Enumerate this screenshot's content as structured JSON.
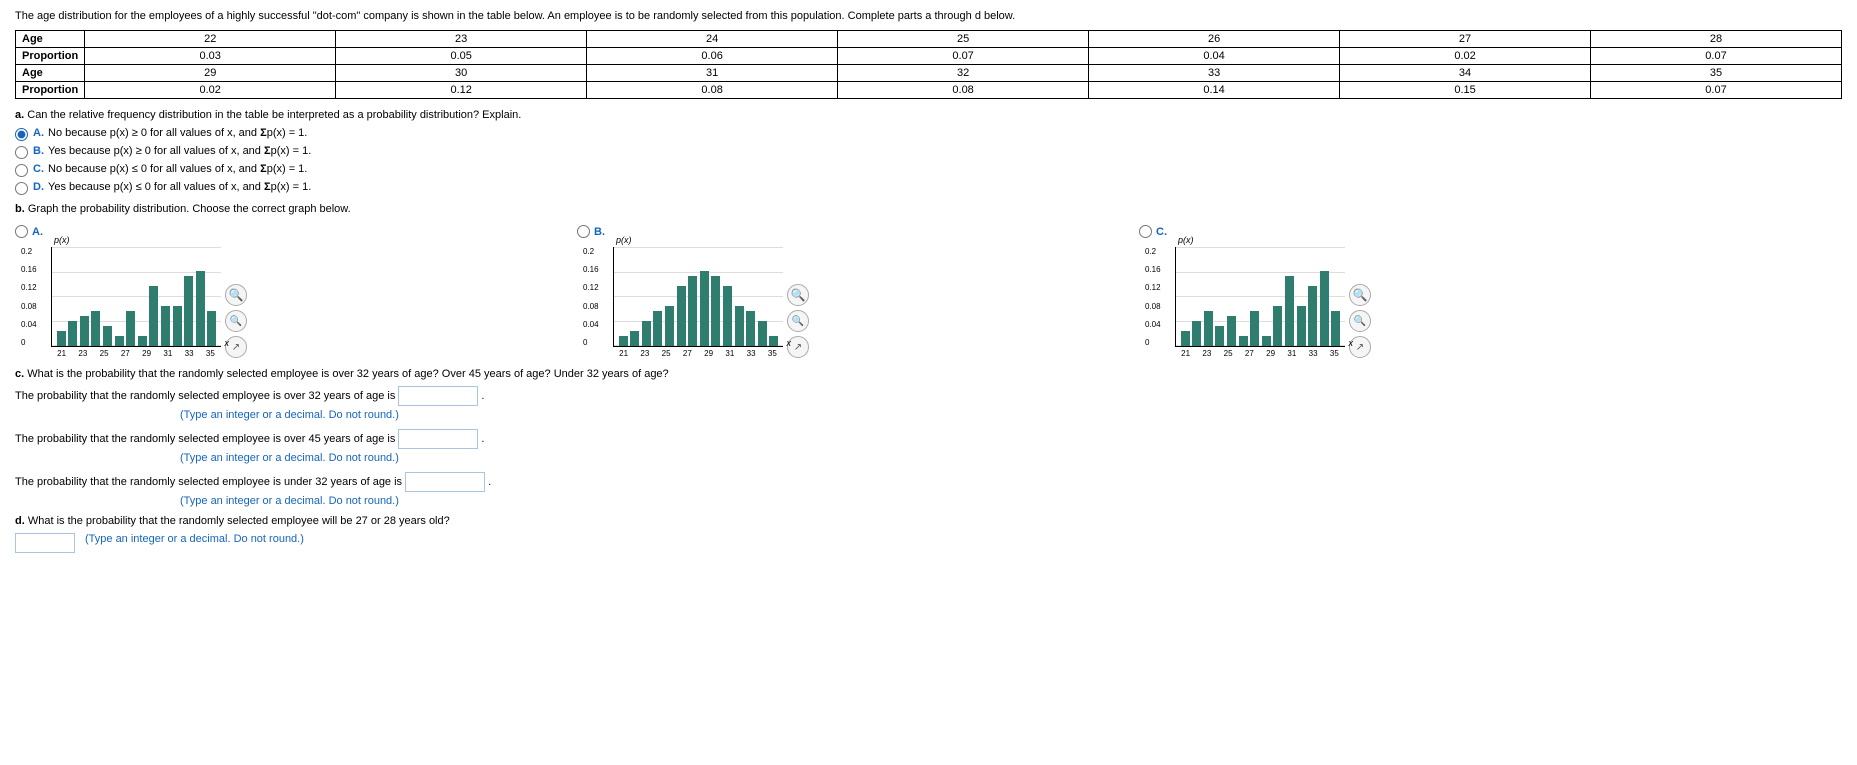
{
  "intro": "The age distribution for the employees of a highly successful \"dot-com\" company is shown in the table below. An employee is to be randomly selected from this population. Complete parts a through d below.",
  "table": {
    "row1": {
      "headers": [
        "Age",
        "22",
        "23",
        "24",
        "25",
        "26",
        "27",
        "28"
      ],
      "proportions": [
        "Proportion",
        "0.03",
        "0.05",
        "0.06",
        "0.07",
        "0.04",
        "0.02",
        "0.07"
      ]
    },
    "row2": {
      "headers": [
        "Age",
        "29",
        "30",
        "31",
        "32",
        "33",
        "34",
        "35"
      ],
      "proportions": [
        "Proportion",
        "0.02",
        "0.12",
        "0.08",
        "0.08",
        "0.14",
        "0.15",
        "0.07"
      ]
    }
  },
  "partA": {
    "label": "a.",
    "question": "Can the relative frequency distribution in the table be interpreted as a probability distribution? Explain.",
    "options": [
      {
        "id": "optA",
        "label": "A.",
        "text": "No because p(x) ≥ 0 for all values of x, and ",
        "sigma": "Σ",
        "pxeq1": "p(x) = 1.",
        "selected": true
      },
      {
        "id": "optB",
        "label": "B.",
        "text": "Yes because p(x) ≥ 0 for all values of x, and ",
        "sigma": "Σ",
        "pxeq1": "p(x) = 1.",
        "selected": false
      },
      {
        "id": "optC",
        "label": "C.",
        "text": "No because p(x) ≤ 0 for all values of x, and ",
        "sigma": "Σ",
        "pxeq1": "p(x) = 1.",
        "selected": false
      },
      {
        "id": "optD",
        "label": "D.",
        "text": "Yes because p(x) ≤ 0 for all values of x, and ",
        "sigma": "Σ",
        "pxeq1": "p(x) = 1.",
        "selected": false
      }
    ]
  },
  "partB": {
    "label": "b.",
    "question": "Graph the probability distribution. Choose the correct graph below.",
    "graphs": [
      {
        "id": "graphA",
        "label": "A.",
        "selected": false,
        "bars": [
          0.03,
          0.05,
          0.06,
          0.07,
          0.04,
          0.02,
          0.07,
          0.02,
          0.12,
          0.08,
          0.08,
          0.14,
          0.15,
          0.07
        ]
      },
      {
        "id": "graphB",
        "label": "B.",
        "selected": false,
        "bars": [
          0.02,
          0.03,
          0.05,
          0.07,
          0.08,
          0.12,
          0.14,
          0.15,
          0.14,
          0.12,
          0.08,
          0.07,
          0.05,
          0.02
        ]
      },
      {
        "id": "graphC",
        "label": "C.",
        "selected": false,
        "bars": [
          0.03,
          0.05,
          0.07,
          0.04,
          0.06,
          0.02,
          0.07,
          0.02,
          0.08,
          0.14,
          0.08,
          0.12,
          0.15,
          0.07
        ]
      }
    ],
    "yLabels": [
      "0.2",
      "0.16",
      "0.12",
      "0.08",
      "0.04"
    ],
    "xLabels": [
      "21",
      "23",
      "25",
      "27",
      "29",
      "31",
      "33",
      "35"
    ]
  },
  "partC": {
    "label": "c.",
    "question": "What is the probability that the randomly selected employee is over 32 years of age? Over 45 years of age? Under 32 years of age?",
    "q1": {
      "text": "The probability that the randomly selected employee is over 32 years of age is",
      "hint": "(Type an integer or a decimal. Do not round.)",
      "value": ""
    },
    "q2": {
      "text": "The probability that the randomly selected employee is over 45 years of age is",
      "hint": "(Type an integer or a decimal. Do not round.)",
      "value": ""
    },
    "q3": {
      "text": "The probability that the randomly selected employee is under 32 years of age is",
      "hint": "(Type an integer or a decimal. Do not round.)",
      "value": ""
    }
  },
  "partD": {
    "label": "d.",
    "question": "What is the probability that the randomly selected employee will be 27 or 28 years old?",
    "hint": "(Type an integer or a decimal. Do not round.)",
    "value": ""
  }
}
